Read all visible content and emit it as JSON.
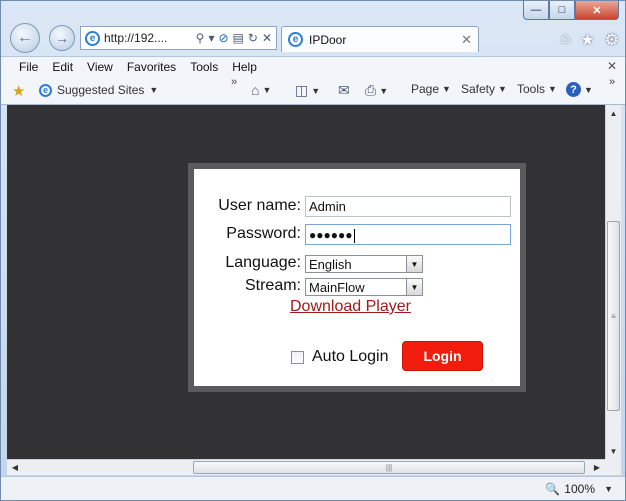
{
  "browser": {
    "address": "http://192....",
    "tab_title": "IPDoor",
    "menu": [
      "File",
      "Edit",
      "View",
      "Favorites",
      "Tools",
      "Help"
    ],
    "favorites": {
      "suggested_sites": "Suggested Sites"
    },
    "command_bar": {
      "page": "Page",
      "safety": "Safety",
      "tools": "Tools"
    },
    "zoom": "100%"
  },
  "login": {
    "username_label": "User name:",
    "username_value": "Admin",
    "password_label": "Password:",
    "password_value": "●●●●●●",
    "language_label": "Language:",
    "language_value": "English",
    "stream_label": "Stream:",
    "stream_value": "MainFlow",
    "download_link": "Download Player",
    "auto_login_label": "Auto Login",
    "auto_login_checked": false,
    "login_button": "Login",
    "login_button_color": "#f21c0c"
  }
}
